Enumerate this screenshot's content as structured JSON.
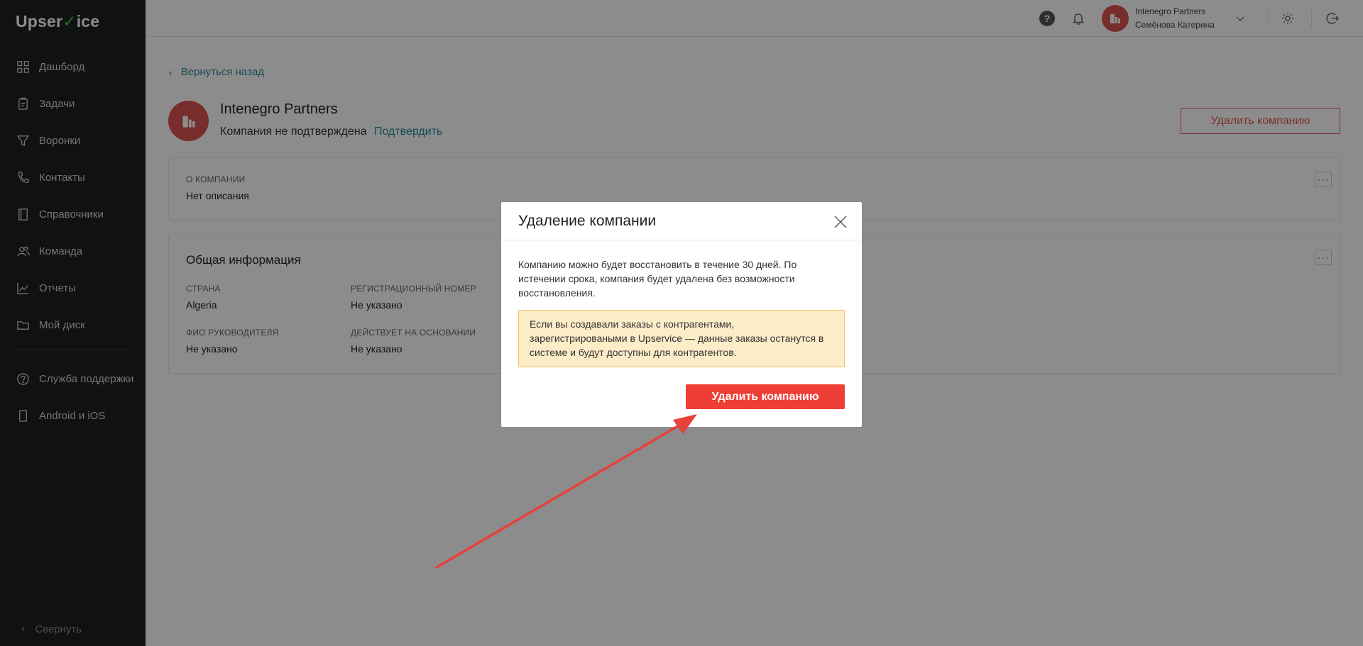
{
  "sidebar": {
    "logo_left": "Upser",
    "logo_tick": "✓",
    "logo_right": "ice",
    "items": [
      {
        "label": "Дашборд",
        "icon": "dashboard-icon"
      },
      {
        "label": "Задачи",
        "icon": "tasks-icon"
      },
      {
        "label": "Воронки",
        "icon": "funnel-icon"
      },
      {
        "label": "Контакты",
        "icon": "phone-icon"
      },
      {
        "label": "Справочники",
        "icon": "book-icon"
      },
      {
        "label": "Команда",
        "icon": "team-icon"
      },
      {
        "label": "Отчеты",
        "icon": "chart-icon"
      },
      {
        "label": "Мой диск",
        "icon": "folder-icon"
      }
    ],
    "bottom_items": [
      {
        "label": "Служба поддержки",
        "icon": "help-icon"
      },
      {
        "label": "Android и iOS",
        "icon": "mobile-icon"
      }
    ],
    "collapse_label": "Свернуть"
  },
  "header": {
    "company": "Intenegro Partners",
    "user": "Семёнова Катерина",
    "help_glyph": "?"
  },
  "main": {
    "back_label": "Вернуться назад",
    "company_name": "Intenegro Partners",
    "status_text": "Компания не подтверждена",
    "confirm_label": "Подтвердить",
    "delete_label": "Удалить компанию",
    "about": {
      "label": "О компании",
      "value": "Нет описания"
    },
    "general": {
      "title": "Общая информация",
      "fields": [
        {
          "label": "Страна",
          "value": "Algeria"
        },
        {
          "label": "Регистрационный номер",
          "value": "Не указано"
        },
        {
          "label": "ФИО руководителя",
          "value": "Не указано"
        },
        {
          "label": "Действует на основании",
          "value": "Не указано"
        }
      ]
    },
    "dots_glyph": "···"
  },
  "modal": {
    "title": "Удаление компании",
    "text": "Компанию можно будет восстановить в течение 30 дней. По истечении срока, компания будет удалена без возможности восстановления.",
    "warning": "Если вы создавали заказы с контрагентами, зарегистрироваными в Upservice — данные заказы останутся в системе и будут доступны для контрагентов.",
    "delete_label": "Удалить компанию"
  },
  "colors": {
    "sidebar_bg": "#1e1f21",
    "accent_teal": "#2a8a94",
    "danger": "#ee3e36",
    "annotation_arrow": "#e8403a"
  }
}
